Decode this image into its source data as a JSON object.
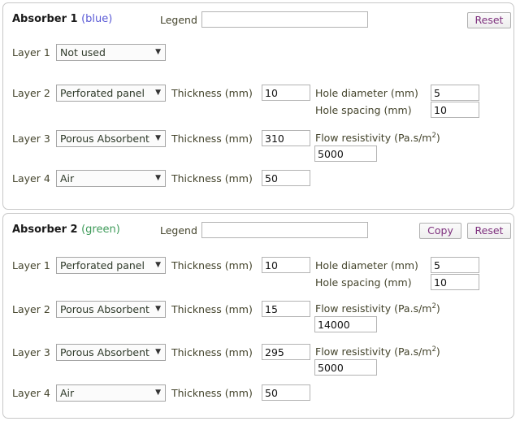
{
  "absorbers": [
    {
      "id": "absorber-1",
      "title": "Absorber 1",
      "color_name": "(blue)",
      "color_hex": "#5b5bd6",
      "legend_label": "Legend",
      "legend_value": "",
      "legend_placeholder": "",
      "buttons": {
        "reset": "Reset"
      },
      "layers": [
        {
          "label": "Layer 1",
          "material": "Not used",
          "arrow": "▼",
          "fields": []
        },
        {
          "label": "Layer 2",
          "material": "Perforated panel",
          "arrow": "▼",
          "thickness_label": "Thickness (mm)",
          "thickness_value": "10",
          "hole_diameter_label": "Hole diameter (mm)",
          "hole_diameter_value": "5",
          "hole_spacing_label": "Hole spacing (mm)",
          "hole_spacing_value": "10"
        },
        {
          "label": "Layer 3",
          "material": "Porous Absorbent",
          "arrow": "▼",
          "thickness_label": "Thickness (mm)",
          "thickness_value": "310",
          "flow_label_text": "Flow resistivity (Pa.s/m",
          "flow_label_sup": "2",
          "flow_label_close": ")",
          "flow_value": "5000"
        },
        {
          "label": "Layer 4",
          "material": "Air",
          "arrow": "▼",
          "thickness_label": "Thickness (mm)",
          "thickness_value": "50"
        }
      ]
    },
    {
      "id": "absorber-2",
      "title": "Absorber 2",
      "color_name": "(green)",
      "color_hex": "#3f9b5a",
      "legend_label": "Legend",
      "legend_value": "",
      "legend_placeholder": "",
      "buttons": {
        "copy": "Copy",
        "reset": "Reset"
      },
      "layers": [
        {
          "label": "Layer 1",
          "material": "Perforated panel",
          "arrow": "▼",
          "thickness_label": "Thickness (mm)",
          "thickness_value": "10",
          "hole_diameter_label": "Hole diameter (mm)",
          "hole_diameter_value": "5",
          "hole_spacing_label": "Hole spacing (mm)",
          "hole_spacing_value": "10"
        },
        {
          "label": "Layer 2",
          "material": "Porous Absorbent",
          "arrow": "▼",
          "thickness_label": "Thickness (mm)",
          "thickness_value": "15",
          "flow_label_text": "Flow resistivity (Pa.s/m",
          "flow_label_sup": "2",
          "flow_label_close": ")",
          "flow_value": "14000"
        },
        {
          "label": "Layer 3",
          "material": "Porous Absorbent",
          "arrow": "▼",
          "thickness_label": "Thickness (mm)",
          "thickness_value": "295",
          "flow_label_text": "Flow resistivity (Pa.s/m",
          "flow_label_sup": "2",
          "flow_label_close": ")",
          "flow_value": "5000"
        },
        {
          "label": "Layer 4",
          "material": "Air",
          "arrow": "▼",
          "thickness_label": "Thickness (mm)",
          "thickness_value": "50"
        }
      ]
    }
  ]
}
